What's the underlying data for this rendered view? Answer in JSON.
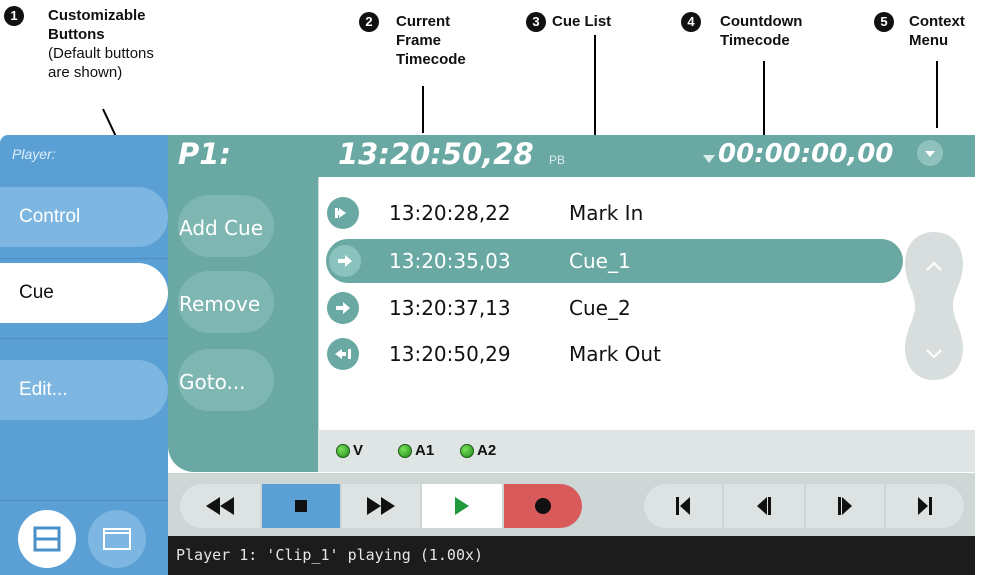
{
  "callouts": [
    {
      "n": "1",
      "title": "Customizable\nButtons",
      "note": "(Default buttons\nare shown)"
    },
    {
      "n": "2",
      "title": "Current\nFrame\nTimecode"
    },
    {
      "n": "3",
      "title": "Cue List"
    },
    {
      "n": "4",
      "title": "Countdown\nTimecode"
    },
    {
      "n": "5",
      "title": "Context\nMenu"
    }
  ],
  "sidebar": {
    "player_label": "Player:",
    "items": [
      {
        "label": "Control"
      },
      {
        "label": "Cue",
        "selected": true
      },
      {
        "label": "Edit..."
      }
    ]
  },
  "topbar": {
    "channel": "P1:",
    "current_timecode": "13:20:50,28",
    "mode": "PB",
    "countdown_timecode": "00:00:00,00"
  },
  "cue_buttons": [
    {
      "label": "Add Cue"
    },
    {
      "label": "Remove"
    },
    {
      "label": "Goto..."
    }
  ],
  "cue_list": [
    {
      "icon": "mark-in-icon",
      "time": "13:20:28,22",
      "name": "Mark In"
    },
    {
      "icon": "cue-arrow-icon",
      "time": "13:20:35,03",
      "name": "Cue_1",
      "selected": true
    },
    {
      "icon": "cue-arrow-icon",
      "time": "13:20:37,13",
      "name": "Cue_2"
    },
    {
      "icon": "mark-out-icon",
      "time": "13:20:50,29",
      "name": "Mark Out"
    }
  ],
  "tracks": [
    "V",
    "A1",
    "A2"
  ],
  "transport": [
    "rewind-icon",
    "stop-icon",
    "fast-forward-icon",
    "play-icon",
    "record-icon",
    "go-to-start-icon",
    "step-back-icon",
    "step-forward-icon",
    "go-to-end-icon"
  ],
  "status": "Player 1: 'Clip_1' playing (1.00x)",
  "colors": {
    "teal": "#6aa9a3",
    "blue": "#5aa0d4",
    "record": "#d85a5a",
    "play": "#1f9a3a",
    "stop_active": "#5aa0d4"
  }
}
